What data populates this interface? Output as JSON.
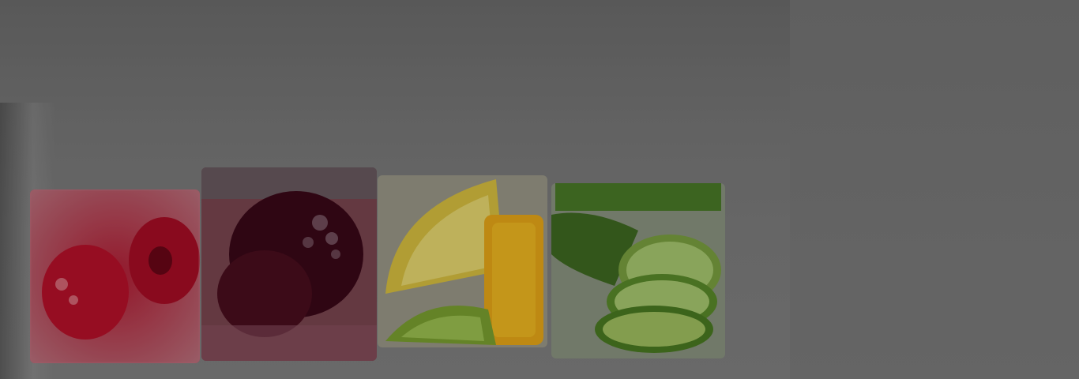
{
  "hero": {
    "subject": "fruit-ice-cubes",
    "cubes": [
      {
        "name": "raspberry-ice-cube",
        "fruit": "raspberry",
        "color": "#b0162a"
      },
      {
        "name": "blackberry-ice-cube",
        "fruit": "blackberry",
        "color": "#4a0f1c"
      },
      {
        "name": "lemon-lime-ice-cube",
        "fruit": "lemon-lime",
        "color": "#e0b21a"
      },
      {
        "name": "cucumber-mint-ice-cube",
        "fruit": "cucumber-mint",
        "color": "#6a9a2a"
      }
    ],
    "overlay_color": "#000000"
  }
}
